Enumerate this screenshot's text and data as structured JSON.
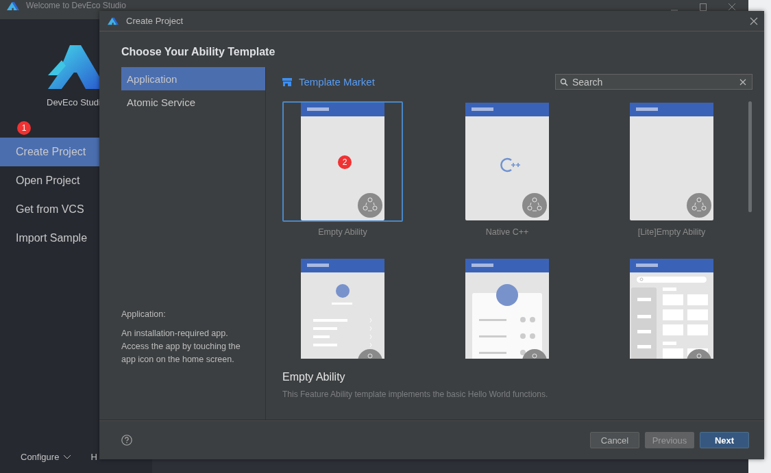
{
  "main_window": {
    "title": "Welcome to DevEco Studio",
    "app_name": "DevEco Studi",
    "badge": "1",
    "nav": [
      {
        "label": "Create Project",
        "selected": true
      },
      {
        "label": "Open Project",
        "selected": false
      },
      {
        "label": "Get from VCS",
        "selected": false
      },
      {
        "label": "Import Sample",
        "selected": false
      }
    ],
    "footer_links": [
      "Configure",
      "H"
    ]
  },
  "dialog": {
    "title": "Create Project",
    "heading": "Choose Your Ability Template",
    "categories": [
      {
        "label": "Application",
        "selected": true
      },
      {
        "label": "Atomic Service",
        "selected": false
      }
    ],
    "description_title": "Application:",
    "description": "An installation-required app. Access the app by touching the app icon on the home screen.",
    "market_link": "Template Market",
    "search": {
      "placeholder": "Search"
    },
    "templates": [
      {
        "name": "Empty Ability",
        "kind": "empty",
        "selected": true,
        "badge": "2"
      },
      {
        "name": "Native C++",
        "kind": "cpp",
        "selected": false
      },
      {
        "name": "[Lite]Empty Ability",
        "kind": "empty",
        "selected": false
      },
      {
        "kind": "profile",
        "selected": false
      },
      {
        "kind": "card",
        "selected": false
      },
      {
        "kind": "grid",
        "selected": false
      }
    ],
    "selected_title": "Empty Ability",
    "selected_description": "This Feature Ability template implements the basic Hello World functions.",
    "buttons": [
      {
        "label": "Cancel",
        "kind": "secondary"
      },
      {
        "label": "Previous",
        "kind": "disabled"
      },
      {
        "label": "Next",
        "kind": "primary"
      }
    ]
  }
}
